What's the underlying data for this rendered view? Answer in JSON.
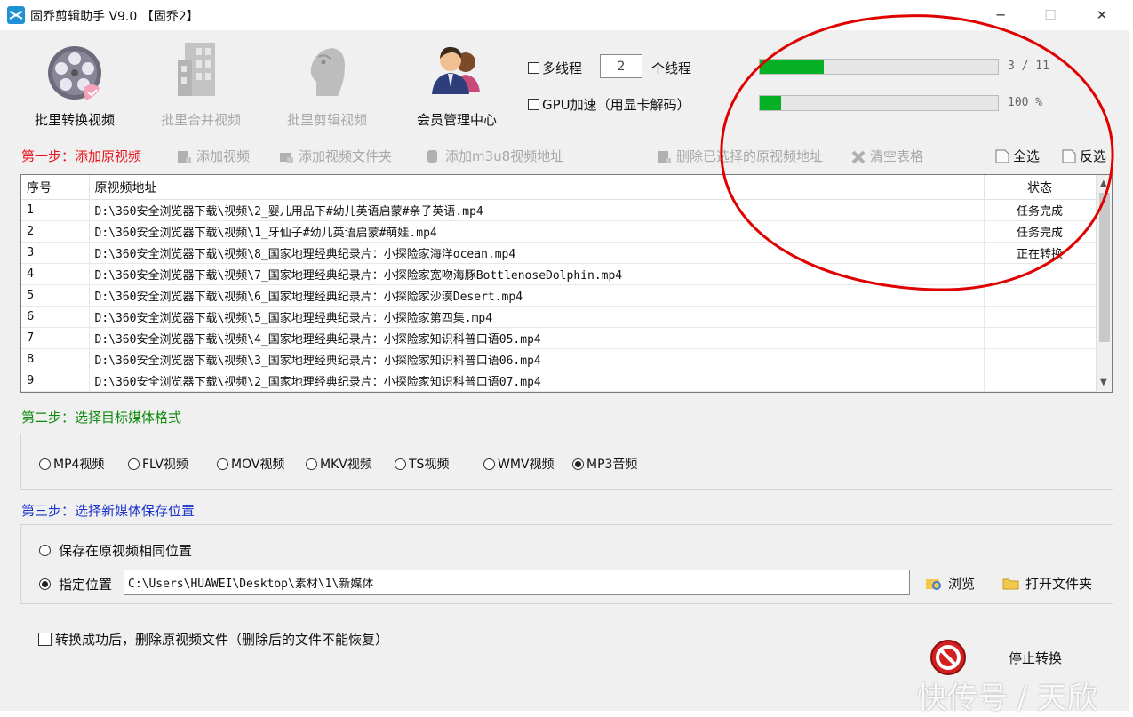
{
  "window": {
    "title": "固乔剪辑助手 V9.0 【固乔2】",
    "minimize_glyph": "─",
    "maximize_glyph": "☐",
    "close_glyph": "✕"
  },
  "toolbar": {
    "batch_convert": "批里转换视频",
    "batch_merge": "批里合并视频",
    "batch_edit": "批里剪辑视频",
    "member_center": "会员管理中心"
  },
  "options": {
    "multithread_label": "多线程",
    "thread_count": "2",
    "thread_unit": "个线程",
    "gpu_label": "GPU加速（用显卡解码）"
  },
  "progress": {
    "overall_text": "3 / 11",
    "overall_fraction": 0.27,
    "current_text": "100 %",
    "current_fraction": 0.09
  },
  "step1": {
    "label": "第一步：添加原视频",
    "add_video": "添加视频",
    "add_folder": "添加视频文件夹",
    "add_m3u8": "添加m3u8视频地址",
    "delete_selected": "删除已选择的原视频地址",
    "clear_table": "清空表格",
    "select_all": "全选",
    "invert": "反选"
  },
  "table": {
    "headers": [
      "序号",
      "原视频地址",
      "状态"
    ],
    "rows": [
      [
        "1",
        "D:\\360安全浏览器下载\\视频\\2_婴儿用品下#幼儿英语启蒙#亲子英语.mp4",
        "任务完成"
      ],
      [
        "2",
        "D:\\360安全浏览器下载\\视频\\1_牙仙子#幼儿英语启蒙#萌娃.mp4",
        "任务完成"
      ],
      [
        "3",
        "D:\\360安全浏览器下载\\视频\\8_国家地理经典纪录片：小探险家海洋ocean.mp4",
        "正在转换"
      ],
      [
        "4",
        "D:\\360安全浏览器下载\\视频\\7_国家地理经典纪录片：小探险家宽吻海豚BottlenoseDolphin.mp4",
        ""
      ],
      [
        "5",
        "D:\\360安全浏览器下载\\视频\\6_国家地理经典纪录片：小探险家沙漠Desert.mp4",
        ""
      ],
      [
        "6",
        "D:\\360安全浏览器下载\\视频\\5_国家地理经典纪录片：小探险家第四集.mp4",
        ""
      ],
      [
        "7",
        "D:\\360安全浏览器下载\\视频\\4_国家地理经典纪录片：小探险家知识科普口语05.mp4",
        ""
      ],
      [
        "8",
        "D:\\360安全浏览器下载\\视频\\3_国家地理经典纪录片：小探险家知识科普口语06.mp4",
        ""
      ],
      [
        "9",
        "D:\\360安全浏览器下载\\视频\\2_国家地理经典纪录片：小探险家知识科普口语07.mp4",
        ""
      ]
    ]
  },
  "step2": {
    "label": "第二步：选择目标媒体格式",
    "formats": [
      "MP4视频",
      "FLV视频",
      "MOV视频",
      "MKV视频",
      "TS视频",
      "WMV视频",
      "MP3音频"
    ],
    "selected": "MP3音频"
  },
  "step3": {
    "label": "第三步：选择新媒体保存位置",
    "same_location": "保存在原视频相同位置",
    "custom_location": "指定位置",
    "path": "C:\\Users\\HUAWEI\\Desktop\\素材\\1\\新媒体",
    "browse": "浏览",
    "open_folder": "打开文件夹"
  },
  "footer": {
    "delete_after": "转换成功后，删除原视频文件（删除后的文件不能恢复）",
    "stop": "停止转换"
  },
  "watermark": "快传号 / 天欣",
  "colors": {
    "step1": "#e8141a",
    "step2": "#0d8a0d",
    "step3": "#1a33cc",
    "progress_fill": "#06b025",
    "annotation_circle": "#e00000"
  }
}
